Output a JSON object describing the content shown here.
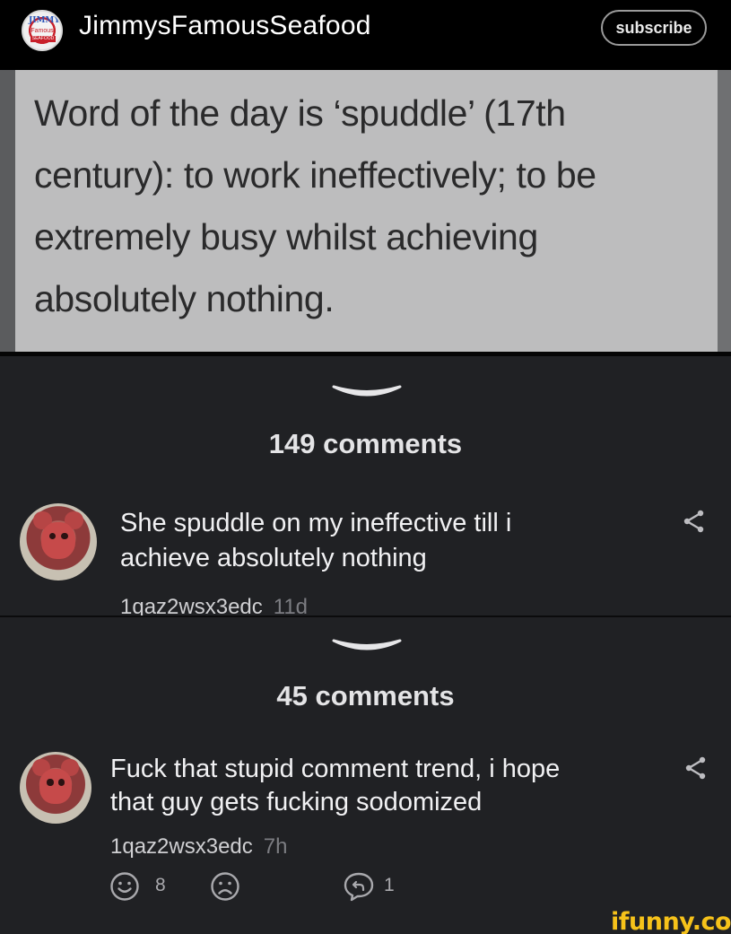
{
  "header": {
    "channel_name": "JimmysFamousSeafood",
    "subscribe_label": "subscribe",
    "logo": {
      "top": "JIMMY'S",
      "middle": "Famous",
      "bottom": "SEAFOOD"
    }
  },
  "post": {
    "lines": [
      "Word of the day is ‘spuddle’ (17th",
      "century): to work ineffectively; to be",
      "extremely busy whilst achieving",
      "absolutely nothing."
    ]
  },
  "sections": [
    {
      "comments_count": "149 comments",
      "comment": {
        "lines": [
          "She spuddle on my ineffective till i",
          "achieve absolutely nothing"
        ],
        "username": "1qaz2wsx3edc",
        "time": "11d"
      }
    },
    {
      "comments_count": "45 comments",
      "comment": {
        "lines": [
          "Fuck that stupid comment trend, i hope",
          "that guy gets fucking sodomized"
        ],
        "username": "1qaz2wsx3edc",
        "time": "7h"
      },
      "actions": {
        "smile_count": "8",
        "reply_count": "1"
      }
    }
  ],
  "watermark": "ifunny.co",
  "icons": [
    "chevron-down-icon",
    "share-icon",
    "smile-icon",
    "frown-icon",
    "reply-icon"
  ],
  "colors": {
    "background": "#202124",
    "watermark": "#f6c21a"
  }
}
